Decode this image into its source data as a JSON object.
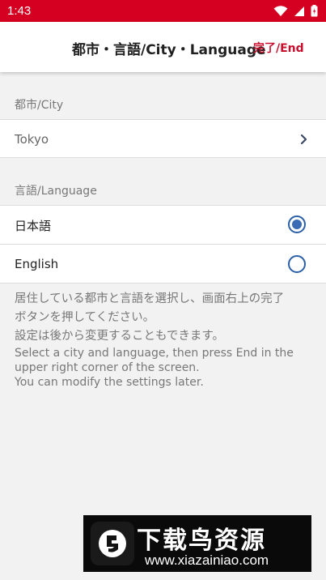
{
  "status_bar": {
    "time": "1:43",
    "icons": [
      "wifi-icon",
      "signal-icon",
      "battery-icon"
    ]
  },
  "header": {
    "title": "都市・言語/City・Language",
    "done_label": "完了/End"
  },
  "city_section": {
    "label": "都市/City",
    "value": "Tokyo",
    "icon": "chevron-right-icon"
  },
  "language_section": {
    "label": "言語/Language",
    "options": [
      {
        "label": "日本語",
        "selected": true
      },
      {
        "label": "English",
        "selected": false
      }
    ]
  },
  "help": {
    "ja_line1": "居住している都市と言語を選択し、画面右上の完了",
    "ja_line2": "ボタンを押してください。",
    "ja_line3": "設定は後から変更することもできます。",
    "en_line1": "Select a city and language, then press End in the",
    "en_line2": "upper right corner of the screen.",
    "en_line3": "You can modify the settings later."
  },
  "watermark": {
    "title": "下载鸟资源",
    "url": "www.xiazainiao.com"
  },
  "colors": {
    "status_bar": "#d50021",
    "accent_red": "#c8102e",
    "radio_blue": "#3a6bb5",
    "background": "#f2f2f2"
  }
}
